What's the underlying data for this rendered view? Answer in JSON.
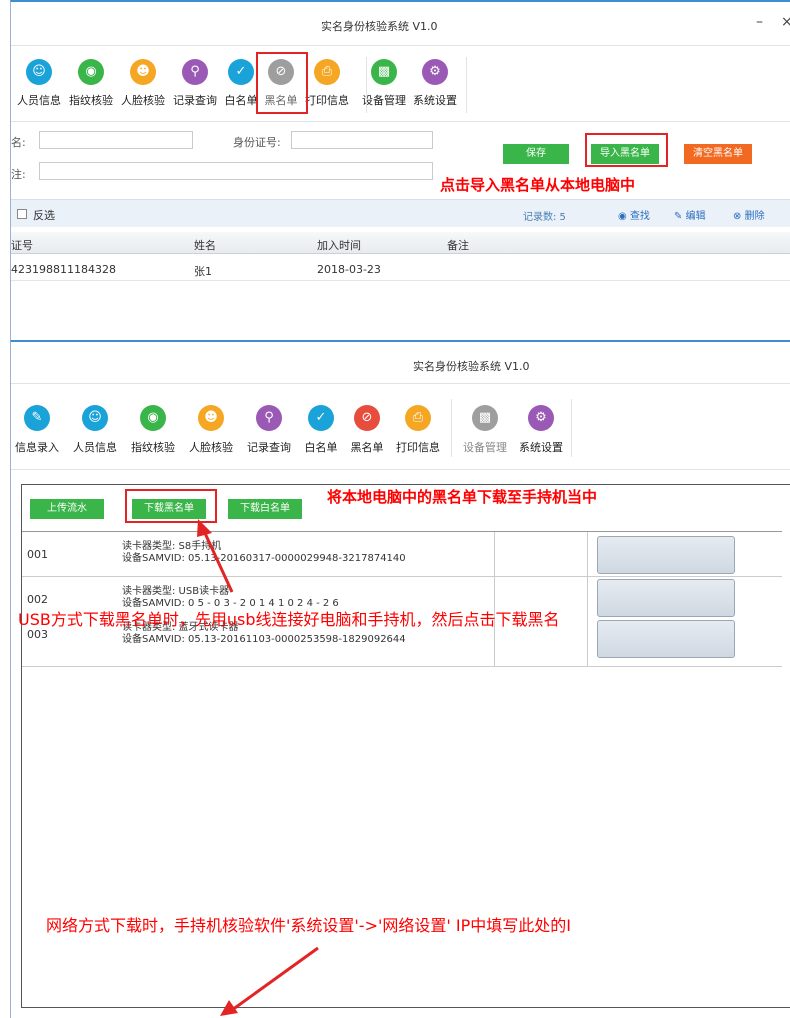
{
  "window1": {
    "title": "实名身份核验系统 V1.0",
    "minimize": "–",
    "close": "×",
    "toolbar": [
      {
        "label": "人员信息",
        "icon": "people-icon",
        "color": "#1aa3d8"
      },
      {
        "label": "指纹核验",
        "icon": "fingerprint-icon",
        "color": "#3ab54a"
      },
      {
        "label": "人脸核验",
        "icon": "face-icon",
        "color": "#f5a623"
      },
      {
        "label": "记录查询",
        "icon": "search-icon",
        "color": "#9b59b6"
      },
      {
        "label": "白名单",
        "icon": "check-icon",
        "color": "#1aa3d8"
      },
      {
        "label": "黑名单",
        "icon": "block-icon",
        "color": "#9e9e9e"
      },
      {
        "label": "打印信息",
        "icon": "printer-icon",
        "color": "#f5a623"
      },
      {
        "label": "设备管理",
        "icon": "device-icon",
        "color": "#3ab54a"
      },
      {
        "label": "系统设置",
        "icon": "settings-icon",
        "color": "#9b59b6"
      }
    ],
    "form": {
      "name_label": "名:",
      "id_label": "身份证号:",
      "note_label": "注:",
      "save": "保存",
      "import_blacklist": "导入黑名单",
      "clear_blacklist": "清空黑名单"
    },
    "filter": {
      "invert_label": "反选",
      "record_count": "记录数: 5",
      "find": "查找",
      "edit": "编辑",
      "delete": "删除"
    },
    "table": {
      "headers": [
        "证号",
        "姓名",
        "加入时间",
        "备注"
      ],
      "rows": [
        [
          "423198811184328",
          "张1",
          "2018-03-23",
          ""
        ]
      ]
    }
  },
  "window2": {
    "title": "实名身份核验系统 V1.0",
    "toolbar": [
      {
        "label": "信息录入",
        "icon": "edit-icon",
        "color": "#1aa3d8"
      },
      {
        "label": "人员信息",
        "icon": "people-icon",
        "color": "#1aa3d8"
      },
      {
        "label": "指纹核验",
        "icon": "fingerprint-icon",
        "color": "#3ab54a"
      },
      {
        "label": "人脸核验",
        "icon": "face-icon",
        "color": "#f5a623"
      },
      {
        "label": "记录查询",
        "icon": "search-icon",
        "color": "#9b59b6"
      },
      {
        "label": "白名单",
        "icon": "check-icon",
        "color": "#1aa3d8"
      },
      {
        "label": "黑名单",
        "icon": "block-icon",
        "color": "#e74c3c"
      },
      {
        "label": "打印信息",
        "icon": "printer-icon",
        "color": "#f5a623"
      },
      {
        "label": "设备管理",
        "icon": "device-icon",
        "color": "#9e9e9e"
      },
      {
        "label": "系统设置",
        "icon": "settings-icon",
        "color": "#9b59b6"
      }
    ],
    "buttons": {
      "upload": "上传流水",
      "download_black": "下载黑名单",
      "download_white": "下载白名单"
    },
    "devices": [
      {
        "num": "001",
        "type": "读卡器类型: S8手持机",
        "sam": "设备SAMVID: 05.13-20160317-0000029948-3217874140"
      },
      {
        "num": "002",
        "type": "读卡器类型: USB读卡器",
        "sam": "设备SAMVID: 0 5 - 0 3 - 2 0 1 4 1 0 2 4 - 2 6"
      },
      {
        "num": "003",
        "type": "读卡器类型: 蓝牙式读卡器",
        "sam": "设备SAMVID: 05.13-20161103-0000253598-1829092644"
      }
    ]
  },
  "annotations": {
    "import_tip": "点击导入黑名单从本地电脑中",
    "download_tip": "将本地电脑中的黑名单下载至手持机当中",
    "usb_tip": "USB方式下载黑名单时，先用usb线连接好电脑和手持机，然后点击下载黑名",
    "network_tip": "网络方式下载时，手持机核验软件'系统设置'->'网络设置' IP中填写此处的I"
  }
}
